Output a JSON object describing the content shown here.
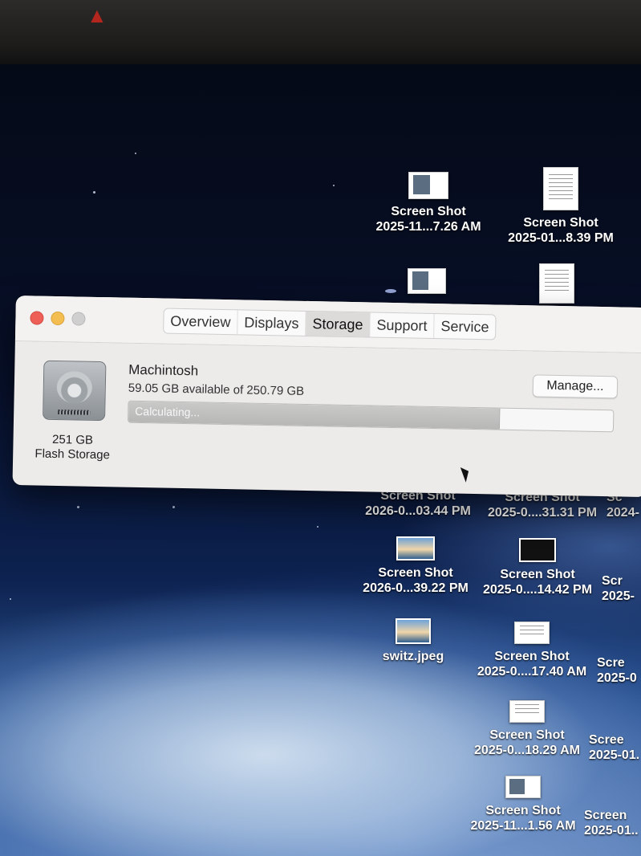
{
  "window": {
    "tabs": [
      {
        "label": "Overview"
      },
      {
        "label": "Displays"
      },
      {
        "label": "Storage",
        "active": true
      },
      {
        "label": "Support"
      },
      {
        "label": "Service"
      }
    ],
    "disk": {
      "size": "251 GB",
      "type": "Flash Storage"
    },
    "volume": {
      "name": "Machintosh",
      "availability": "59.05 GB available of 250.79 GB",
      "manage_label": "Manage...",
      "status": "Calculating...",
      "used_fraction": 0.765
    }
  },
  "desktop_icons": [
    {
      "line1": "Screen Shot",
      "line2": "2025-11...7.26 AM"
    },
    {
      "line1": "Screen Shot",
      "line2": "2025-01...8.39 PM"
    },
    {
      "line1": "Screen Shot",
      "line2": "2026-0...03.44 PM"
    },
    {
      "line1": "Screen Shot",
      "line2": "2025-0....31.31 PM"
    },
    {
      "line1": "Screen Shot",
      "line2": "2026-0...39.22 PM"
    },
    {
      "line1": "Screen Shot",
      "line2": "2025-0....14.42 PM"
    },
    {
      "line1": "switz.jpeg",
      "line2": ""
    },
    {
      "line1": "Screen Shot",
      "line2": "2025-0....17.40 AM"
    },
    {
      "line1": "Screen Shot",
      "line2": "2025-0...18.29 AM"
    },
    {
      "line1": "Screen Shot",
      "line2": "2025-11...1.56 AM"
    }
  ],
  "edge_labels": [
    {
      "line1": "Sc",
      "line2": "2024-"
    },
    {
      "line1": "Scr",
      "line2": "2025-"
    },
    {
      "line1": "Scre",
      "line2": "2025-0"
    },
    {
      "line1": "Scree",
      "line2": "2025-01."
    },
    {
      "line1": "Screen",
      "line2": "2025-01.."
    }
  ]
}
